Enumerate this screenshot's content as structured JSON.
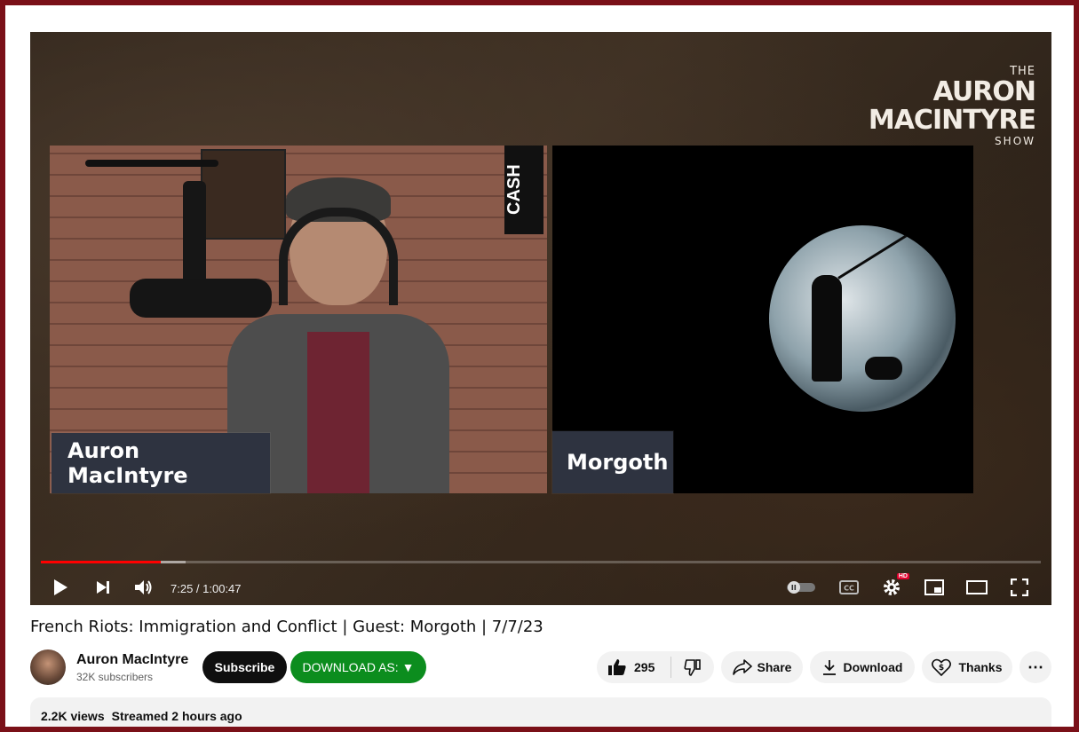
{
  "video": {
    "show_logo": {
      "the": "THE",
      "name_line1": "AURON",
      "name_line2": "MACINTYRE",
      "show": "SHOW"
    },
    "left_nameplate": "Auron MacIntyre",
    "right_nameplate": "Morgoth",
    "poster_text": "CASH",
    "progress": {
      "played_fraction": 0.12,
      "buffered_fraction": 0.145
    },
    "time_display": "7:25 / 1:00:47"
  },
  "title": "French Riots: Immigration and Conflict | Guest: Morgoth | 7/7/23",
  "channel": {
    "name": "Auron MacIntyre",
    "subscribers": "32K subscribers"
  },
  "actions": {
    "subscribe_label": "Subscribe",
    "download_as_label": "DOWNLOAD AS:",
    "download_as_arrow": "▼",
    "like_count": "295",
    "share_label": "Share",
    "download_label": "Download",
    "thanks_label": "Thanks",
    "more_label": "⋯"
  },
  "description": {
    "views": "2.2K views",
    "streamed": "Streamed 2 hours ago"
  },
  "colors": {
    "frame": "#7a1018",
    "progress_red": "#ff0000",
    "download_as_green": "#0c8d1e"
  }
}
